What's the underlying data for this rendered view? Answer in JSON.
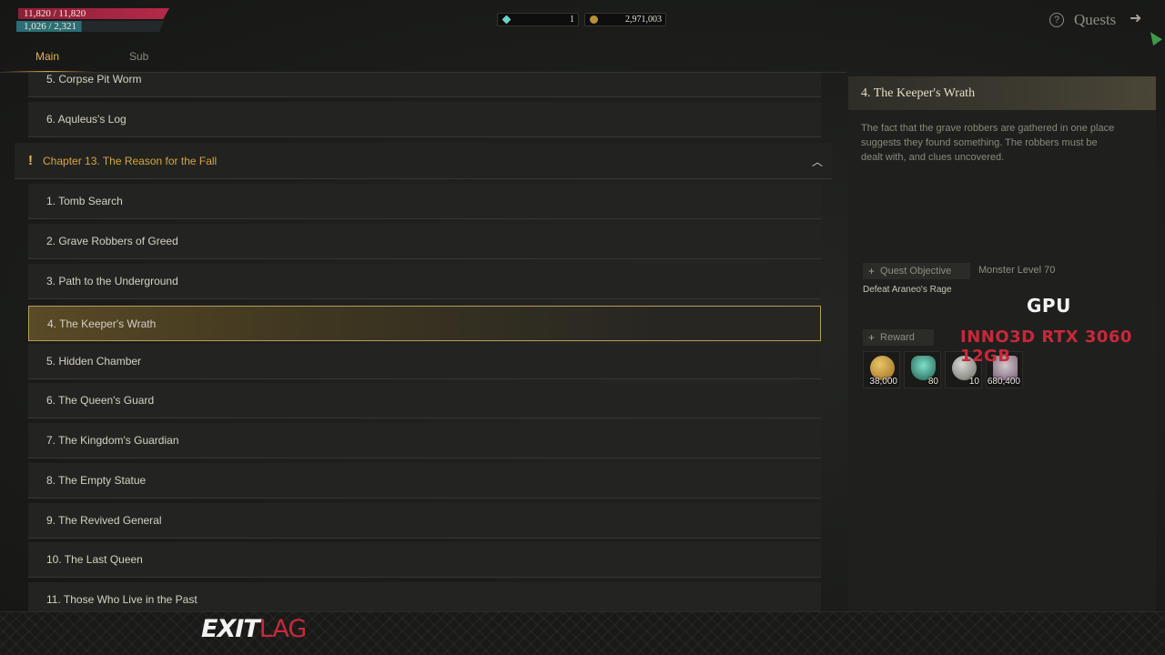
{
  "player": {
    "hp": "11,820 / 11,820",
    "mp": "1,026 / 2,321",
    "mp_fraction": 0.44
  },
  "currencies": [
    {
      "icon": "gem-icon",
      "value": "1"
    },
    {
      "icon": "coin-icon",
      "value": "2,971,003"
    }
  ],
  "header": {
    "help_icon": "question-circle-icon",
    "help_glyph": "?",
    "title": "Quests",
    "exit_icon": "exit-icon"
  },
  "tabs": [
    {
      "label": "Main",
      "active": true
    },
    {
      "label": "Sub",
      "active": false
    }
  ],
  "quest_list": {
    "prev_items": [
      "5. Corpse Pit Worm",
      "6. Aquleus's Log"
    ],
    "chapter": {
      "title": "Chapter 13. The Reason for the Fall",
      "expanded": true
    },
    "items": [
      "1. Tomb Search",
      "2. Grave Robbers of Greed",
      "3. Path to the Underground",
      "4. The Keeper's Wrath",
      "5. Hidden Chamber",
      "6. The Queen's Guard",
      "7. The Kingdom's Guardian",
      "8. The Empty Statue",
      "9. The Revived General",
      "10. The Last Queen",
      "11. Those Who Live in the Past"
    ],
    "selected_index": 3
  },
  "detail": {
    "title": "4. The Keeper's Wrath",
    "description": "The fact that the grave robbers are gathered in one place suggests they found something. The robbers must be dealt with, and clues uncovered.",
    "objective_label": "Quest Objective",
    "monster_level": "Monster Level 70",
    "objective_text": "Defeat Araneo's Rage",
    "reward_label": "Reward",
    "rewards": [
      {
        "icon": "gold-icon",
        "qty": "38,000"
      },
      {
        "icon": "crystal-icon",
        "qty": "80"
      },
      {
        "icon": "silver-medal-icon",
        "qty": "10"
      },
      {
        "icon": "exp-icon",
        "qty": "680,400"
      }
    ]
  },
  "overlay": {
    "gpu_label": "GPU",
    "gpu_model": "INNO3D RTX 3060 12GB",
    "watermark_a": "EXIT",
    "watermark_b": "LAG"
  },
  "colors": {
    "accent_gold": "#d9a441",
    "hp": "#b32a49",
    "mp": "#2c6e74",
    "overlay_red": "#c8283a"
  }
}
